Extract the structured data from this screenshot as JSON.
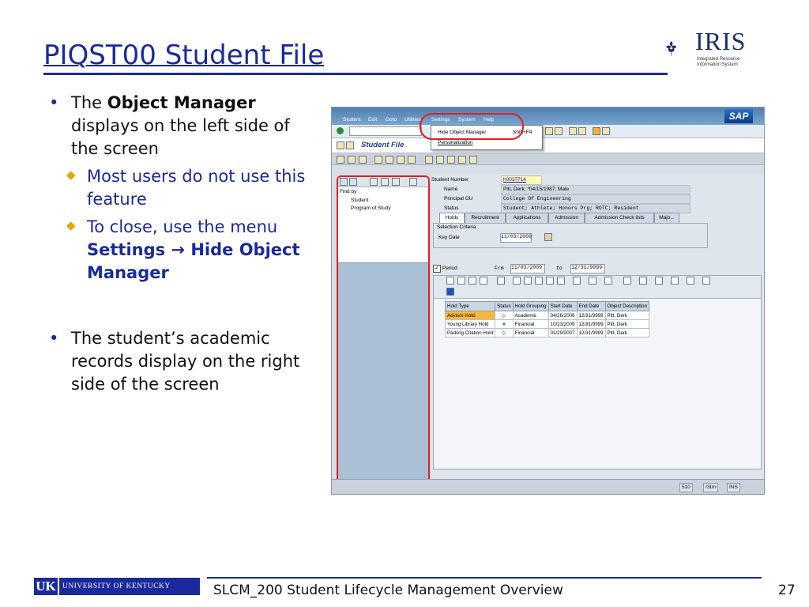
{
  "slide": {
    "title": "PIQST00 Student File",
    "logo_name": "IRIS",
    "logo_subtitle_1": "Integrated Resource",
    "logo_subtitle_2": "Information System",
    "footer_org": "UNIVERSITY OF KENTUCKY",
    "footer_mark": "UK",
    "footer_text": "SLCM_200 Student Lifecycle Management Overview",
    "page_number": "27"
  },
  "bullets": {
    "b1_pre": "The ",
    "b1_bold": "Object Manager",
    "b1_post": "displays on the left side of the screen",
    "sub1": "Most users do not use this feature",
    "sub2_pre": "To close, use the menu ",
    "sub2_bold": "Settings → Hide Object Manager",
    "b2": "The student’s academic records display on the right side of the screen"
  },
  "sap": {
    "menu": [
      "Student",
      "Edit",
      "Goto",
      "Utilities",
      "Settings",
      "System",
      "Help"
    ],
    "logo": "SAP",
    "dropdown_item1": "Hide Object Manager",
    "dropdown_item1_shortcut": "Shift+F4",
    "dropdown_item2": "Personalization",
    "screen_title": "Student File",
    "find_by": "Find by",
    "tree_item1": "Student",
    "tree_item2": "Program of Study",
    "student_number_label": "Student Number",
    "student_number": "h0037714",
    "name_label": "Name",
    "name_value": "Pitt, Derk, *04/15/1987, Male",
    "ou_label": "Principal OU",
    "ou_value": "College Of Engineering",
    "status_label": "Status",
    "status_value": "Student; Athlete; Honors Prg; ROTC; Resident",
    "tabs": [
      "Holds",
      "Recruitment",
      "Applications",
      "Admission",
      "Admission Check lists",
      "Majo..."
    ],
    "selection_criteria": "Selection Criteria",
    "key_date_label": "Key Date",
    "key_date": "11/03/2009",
    "period_label": "Period",
    "from_label": "Frm",
    "from_date": "11/03/2009",
    "to_label": "to",
    "to_date": "12/31/9999",
    "holds_headers": [
      "Hold Type",
      "Status",
      "Hold Grouping",
      "Start Date",
      "End Date",
      "Object Description"
    ],
    "holds_rows": [
      [
        "Advisor Hold",
        "◇",
        "Academic",
        "04/26/2006",
        "12/31/9999",
        "Pitt, Derk"
      ],
      [
        "Young Library Hold",
        "■",
        "Financial",
        "10/23/2009",
        "12/31/9999",
        "Pitt, Derk"
      ],
      [
        "Parking Citation Hold",
        "◇",
        "Financial",
        "01/29/2007",
        "12/31/9999",
        "Pitt, Derk"
      ]
    ],
    "status_bar": [
      "510",
      "r3tm",
      "INS"
    ]
  }
}
